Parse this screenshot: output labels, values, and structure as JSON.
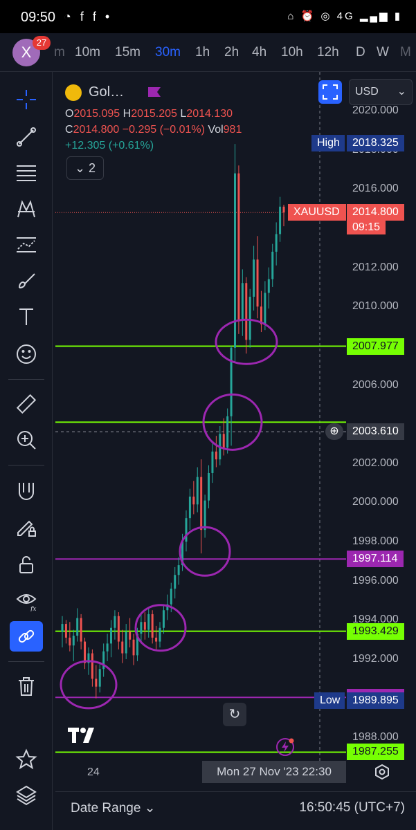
{
  "status_bar": {
    "time": "09:50",
    "left_icons": "◔ f f •",
    "right_icons": "⌂ ⏰ ◎ 4G ▂▄▆ ▮"
  },
  "top_bar": {
    "avatar_letter": "X",
    "badge_count": "27",
    "timeframes": [
      {
        "label": "m",
        "state": "faded"
      },
      {
        "label": "10m",
        "state": "normal"
      },
      {
        "label": "15m",
        "state": "normal"
      },
      {
        "label": "30m",
        "state": "active"
      },
      {
        "label": "1h",
        "state": "normal"
      },
      {
        "label": "2h",
        "state": "normal"
      },
      {
        "label": "4h",
        "state": "normal"
      },
      {
        "label": "10h",
        "state": "normal"
      },
      {
        "label": "12h",
        "state": "normal"
      },
      {
        "label": "D",
        "state": "normal"
      },
      {
        "label": "W",
        "state": "normal"
      },
      {
        "label": "M",
        "state": "faded"
      }
    ]
  },
  "sidebar_tools": [
    {
      "name": "crosshair",
      "active": false
    },
    {
      "name": "trend-line",
      "active": false
    },
    {
      "name": "fib-retracement",
      "active": false
    },
    {
      "name": "pattern",
      "active": false
    },
    {
      "name": "forecast",
      "active": false
    },
    {
      "name": "brush",
      "active": false
    },
    {
      "name": "text",
      "active": false
    },
    {
      "name": "emoji",
      "active": false
    },
    {
      "name": "ruler",
      "active": false
    },
    {
      "name": "zoom-in",
      "active": false
    },
    {
      "name": "magnet",
      "active": false
    },
    {
      "name": "lock-drawing",
      "active": false
    },
    {
      "name": "unlock",
      "active": false
    },
    {
      "name": "eye",
      "active": false
    },
    {
      "name": "link",
      "active": true
    },
    {
      "name": "trash",
      "active": false
    },
    {
      "name": "star",
      "active": false
    },
    {
      "name": "layers",
      "active": false
    }
  ],
  "legend": {
    "symbol": "Gol…",
    "open_label": "O",
    "open": "2015.095",
    "high_label": "H",
    "high": "2015.205",
    "low_label": "L",
    "low": "2014.130",
    "close_label": "C",
    "close": "2014.800",
    "change": "−0.295 (−0.01%)",
    "vol_label": "Vol",
    "vol": "981",
    "day_change": "+12.305 (+0.61%)",
    "collapse_count": "2"
  },
  "currency": "USD",
  "chart_data": {
    "type": "candlestick",
    "y_ticks": [
      "2020.000",
      "2018.000",
      "2016.000",
      "2012.000",
      "2010.000",
      "2006.000",
      "2002.000",
      "2000.000",
      "1998.000",
      "1996.000",
      "1994.000",
      "1992.000",
      "1988.000"
    ],
    "ylim": [
      1986.6,
      2020.0
    ],
    "x_tick": "24",
    "horizontal_lines": [
      {
        "value": 2007.977,
        "color": "#76ff03",
        "label": "2007.977"
      },
      {
        "value": 2004.1,
        "color": "#76ff03",
        "label": ""
      },
      {
        "value": 1997.114,
        "color": "#9c27b0",
        "label": "1997.114"
      },
      {
        "value": 1993.429,
        "color": "#76ff03",
        "label": "1993.429"
      },
      {
        "value": 1990.05,
        "color": "#9c27b0",
        "label": "1990.050"
      },
      {
        "value": 1987.255,
        "color": "#76ff03",
        "label": "1987.255"
      }
    ],
    "high": {
      "label": "High",
      "value": "2018.325"
    },
    "low": {
      "label": "Low",
      "value": "1989.895"
    },
    "last_price": {
      "symbol": "XAUUSD",
      "value": "2014.800",
      "countdown": "09:15",
      "value_num": 2014.8
    },
    "crosshair_value": "2003.610",
    "crosshair_num": 2003.61,
    "candles": [
      [
        1993.4,
        1994.2,
        1992.6,
        1993.8
      ],
      [
        1993.8,
        1994.0,
        1992.8,
        1993.1
      ],
      [
        1993.1,
        1993.9,
        1992.4,
        1992.7
      ],
      [
        1992.7,
        1993.5,
        1991.9,
        1993.2
      ],
      [
        1993.2,
        1994.6,
        1992.9,
        1994.1
      ],
      [
        1994.1,
        1994.3,
        1992.5,
        1992.9
      ],
      [
        1992.9,
        1993.1,
        1991.5,
        1991.8
      ],
      [
        1991.8,
        1992.6,
        1991.2,
        1992.3
      ],
      [
        1992.3,
        1992.5,
        1990.6,
        1991.0
      ],
      [
        1991.0,
        1991.7,
        1990.0,
        1990.6
      ],
      [
        1990.6,
        1991.8,
        1990.3,
        1991.5
      ],
      [
        1991.5,
        1992.8,
        1991.1,
        1992.4
      ],
      [
        1992.4,
        1993.3,
        1991.9,
        1992.8
      ],
      [
        1992.8,
        1994.0,
        1992.1,
        1993.6
      ],
      [
        1993.6,
        1994.5,
        1993.0,
        1994.2
      ],
      [
        1994.2,
        1994.4,
        1992.5,
        1992.9
      ],
      [
        1992.9,
        1993.5,
        1991.8,
        1992.3
      ],
      [
        1992.3,
        1993.8,
        1992.0,
        1993.4
      ],
      [
        1993.4,
        1994.1,
        1992.6,
        1993.0
      ],
      [
        1993.0,
        1993.3,
        1991.7,
        1992.2
      ],
      [
        1992.2,
        1993.6,
        1991.9,
        1993.3
      ],
      [
        1993.3,
        1994.3,
        1992.8,
        1993.9
      ],
      [
        1993.9,
        1994.4,
        1993.0,
        1993.5
      ],
      [
        1993.5,
        1994.6,
        1993.1,
        1994.3
      ],
      [
        1994.3,
        1994.5,
        1992.8,
        1993.1
      ],
      [
        1993.1,
        1993.7,
        1992.5,
        1992.9
      ],
      [
        1992.9,
        1993.9,
        1992.6,
        1993.6
      ],
      [
        1993.6,
        1994.8,
        1993.3,
        1994.5
      ],
      [
        1994.5,
        1995.3,
        1994.0,
        1994.8
      ],
      [
        1994.8,
        1995.9,
        1994.4,
        1995.6
      ],
      [
        1995.6,
        1996.7,
        1995.1,
        1996.3
      ],
      [
        1996.3,
        1997.2,
        1995.8,
        1996.8
      ],
      [
        1996.8,
        1998.4,
        1996.5,
        1998.0
      ],
      [
        1998.0,
        1999.6,
        1997.5,
        1999.2
      ],
      [
        1999.2,
        2000.7,
        1998.6,
        2000.3
      ],
      [
        2000.3,
        2001.1,
        1999.4,
        1999.9
      ],
      [
        1999.9,
        2001.8,
        1999.5,
        2001.3
      ],
      [
        2001.3,
        2002.2,
        1997.4,
        1998.6
      ],
      [
        1998.6,
        2000.4,
        1998.2,
        2000.1
      ],
      [
        2000.1,
        2001.9,
        1999.7,
        2001.5
      ],
      [
        2001.5,
        2003.0,
        2001.0,
        2002.6
      ],
      [
        2002.6,
        2003.4,
        2001.8,
        2002.2
      ],
      [
        2002.2,
        2003.9,
        2001.9,
        2003.5
      ],
      [
        2003.5,
        2004.3,
        2002.4,
        2002.8
      ],
      [
        2002.8,
        2004.8,
        2002.5,
        2004.4
      ],
      [
        2004.4,
        2008.0,
        2002.9,
        2007.9
      ],
      [
        2007.9,
        2018.3,
        2007.2,
        2016.8
      ],
      [
        2016.8,
        2017.2,
        2008.6,
        2009.3
      ],
      [
        2009.3,
        2011.9,
        2008.5,
        2011.2
      ],
      [
        2011.2,
        2011.5,
        2007.6,
        2008.3
      ],
      [
        2008.3,
        2010.9,
        2007.9,
        2010.5
      ],
      [
        2010.5,
        2013.1,
        2009.8,
        2012.4
      ],
      [
        2012.4,
        2013.6,
        2009.4,
        2010.0
      ],
      [
        2010.0,
        2010.8,
        2008.7,
        2009.1
      ],
      [
        2009.1,
        2011.3,
        2008.8,
        2010.7
      ],
      [
        2010.7,
        2012.0,
        2009.9,
        2011.4
      ],
      [
        2011.4,
        2013.2,
        2011.0,
        2012.8
      ],
      [
        2012.8,
        2014.3,
        2012.1,
        2013.7
      ],
      [
        2013.7,
        2015.6,
        2013.3,
        2015.1
      ],
      [
        2015.1,
        2015.2,
        2014.1,
        2014.8
      ]
    ]
  },
  "chart_footer": {
    "date_tag": "Mon 27 Nov '23   22:30",
    "date_range": "Date Range ⌄",
    "clock": "16:50:45 (UTC+7)"
  }
}
